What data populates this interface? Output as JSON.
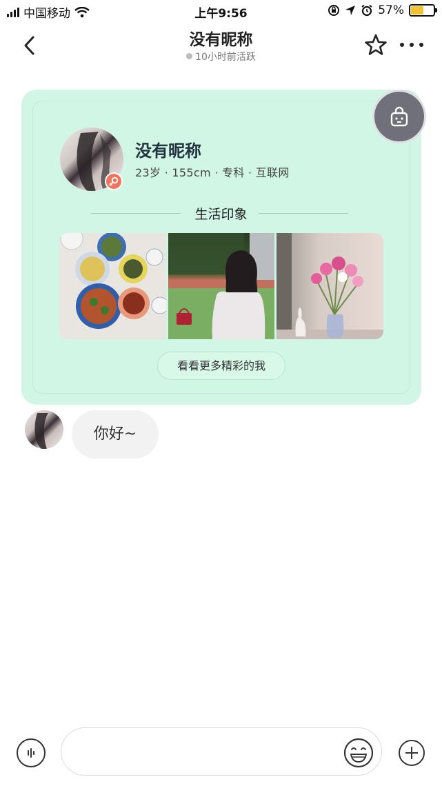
{
  "status_bar": {
    "carrier": "中国移动",
    "time": "上午9:56",
    "battery_percent": "57%",
    "battery_level": 0.57,
    "icons": [
      "signal-icon",
      "wifi-icon",
      "rotation-lock-icon",
      "location-icon",
      "alarm-icon",
      "battery-icon"
    ]
  },
  "header": {
    "title": "没有昵称",
    "subtitle": "10小时前活跃",
    "icons": [
      "back-arrow-icon",
      "star-icon",
      "more-icon"
    ]
  },
  "profile_card": {
    "name": "没有昵称",
    "info": "23岁 · 155cm · 专科 · 互联网",
    "section_title": "生活印象",
    "photos": [
      {
        "subject": "food"
      },
      {
        "subject": "girl"
      },
      {
        "subject": "flower"
      }
    ],
    "more_button": "看看更多精彩的我",
    "icons": [
      "lock-icon",
      "female-icon"
    ],
    "colors": {
      "card_bg": "#d2f6e5",
      "badge": "#f2745f"
    }
  },
  "messages": [
    {
      "from": "other",
      "text": "你好~"
    }
  ],
  "input_bar": {
    "placeholder": "",
    "icons": [
      "voice-icon",
      "emoji-icon",
      "plus-icon"
    ]
  }
}
